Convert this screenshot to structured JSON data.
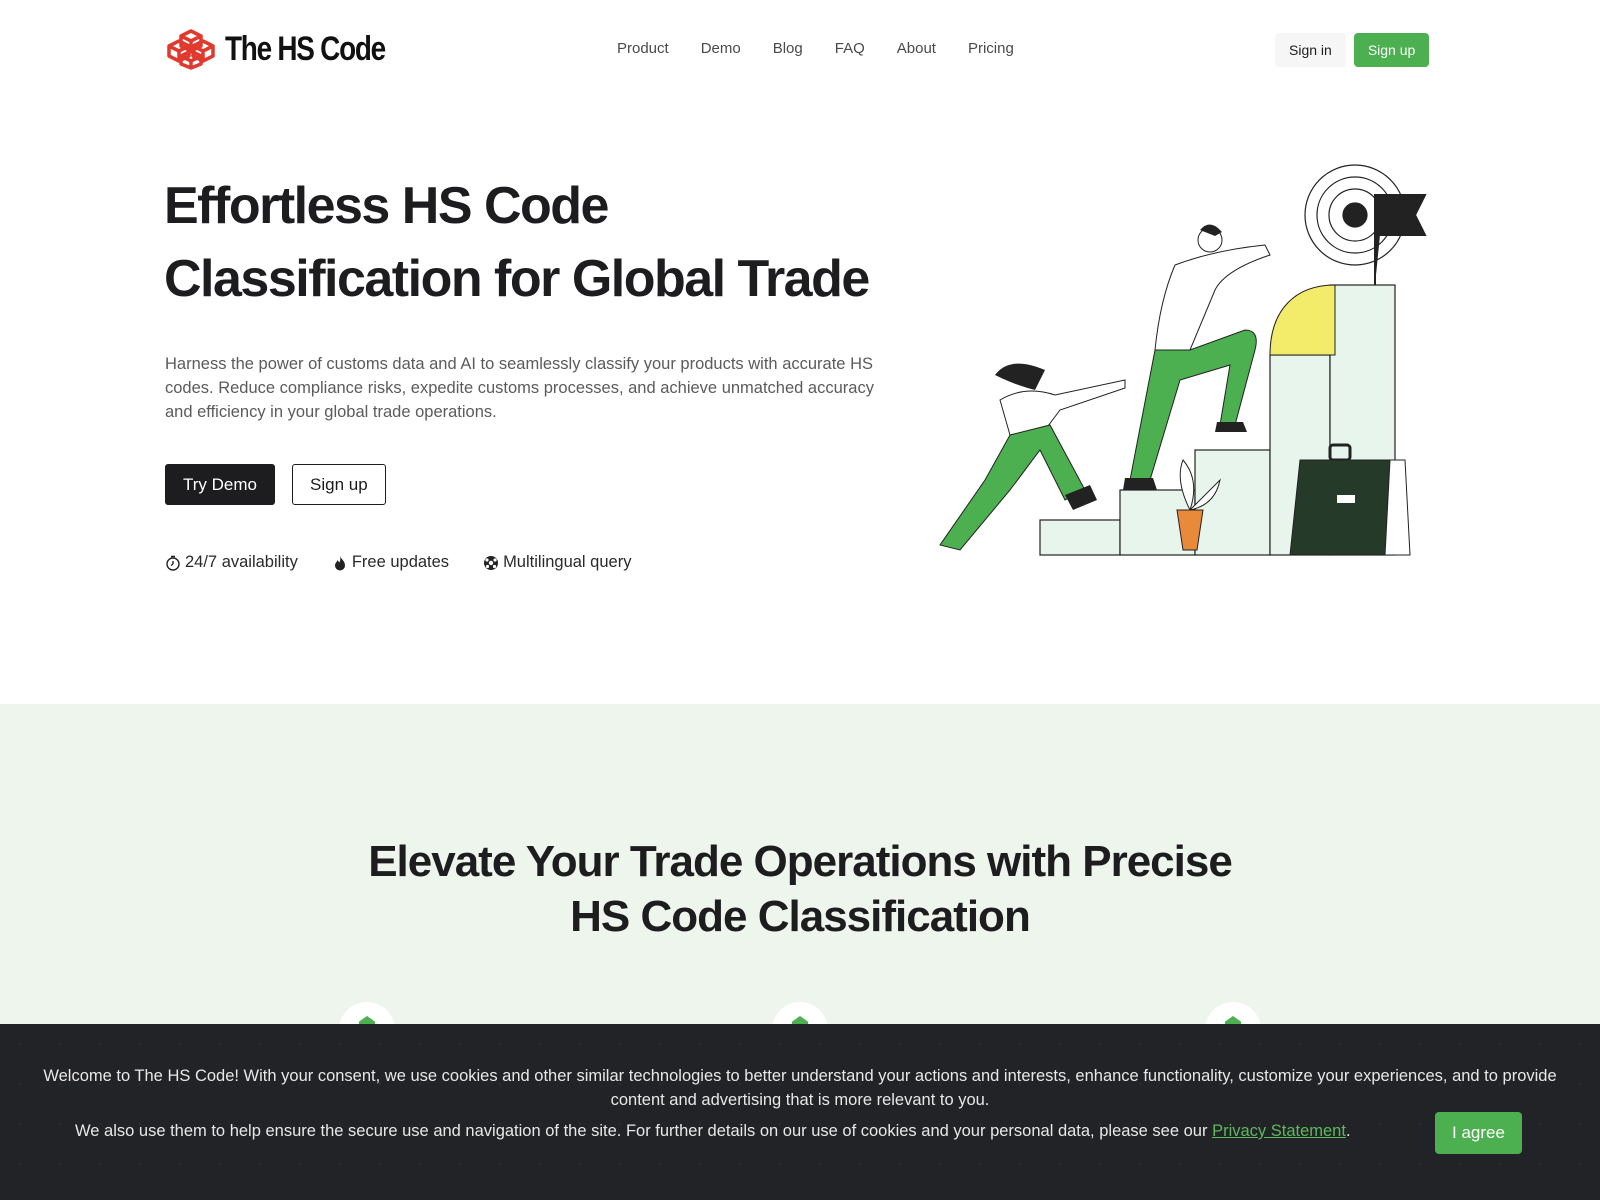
{
  "header": {
    "logo_text": "The HS Code",
    "nav": [
      "Product",
      "Demo",
      "Blog",
      "FAQ",
      "About",
      "Pricing"
    ],
    "sign_in": "Sign in",
    "sign_up": "Sign up"
  },
  "hero": {
    "title_line1": "Effortless HS Code",
    "title_line2": "Classification for Global Trade",
    "description": "Harness the power of customs data and AI to seamlessly classify your products with accurate HS codes. Reduce compliance risks, expedite customs processes, and achieve unmatched accuracy and efficiency in your global trade operations.",
    "try_demo": "Try Demo",
    "sign_up": "Sign up",
    "features": [
      {
        "icon": "stopwatch-icon",
        "label": "24/7 availability"
      },
      {
        "icon": "flame-icon",
        "label": "Free updates"
      },
      {
        "icon": "soccer-ball-icon",
        "label": "Multilingual query"
      }
    ]
  },
  "section2": {
    "title_line1": "Elevate Your Trade Operations with Precise",
    "title_line2": "HS Code Classification"
  },
  "cookie_banner": {
    "text1": "Welcome to The HS Code! With your consent, we use cookies and other similar technologies to better understand your actions and interests, enhance functionality, customize your experiences, and to provide content and advertising that is more relevant to you.",
    "text2_prefix": "We also use them to help ensure the secure use and navigation of the site. For further details on our use of cookies and your personal data, please see our ",
    "privacy_link": "Privacy Statement",
    "text2_suffix": ".",
    "agree": "I agree"
  },
  "colors": {
    "brand_green": "#4caf50",
    "logo_red": "#e03a2f",
    "dark": "#1d1d1f",
    "section_bg": "#eef5ec",
    "banner_bg": "#222326"
  }
}
